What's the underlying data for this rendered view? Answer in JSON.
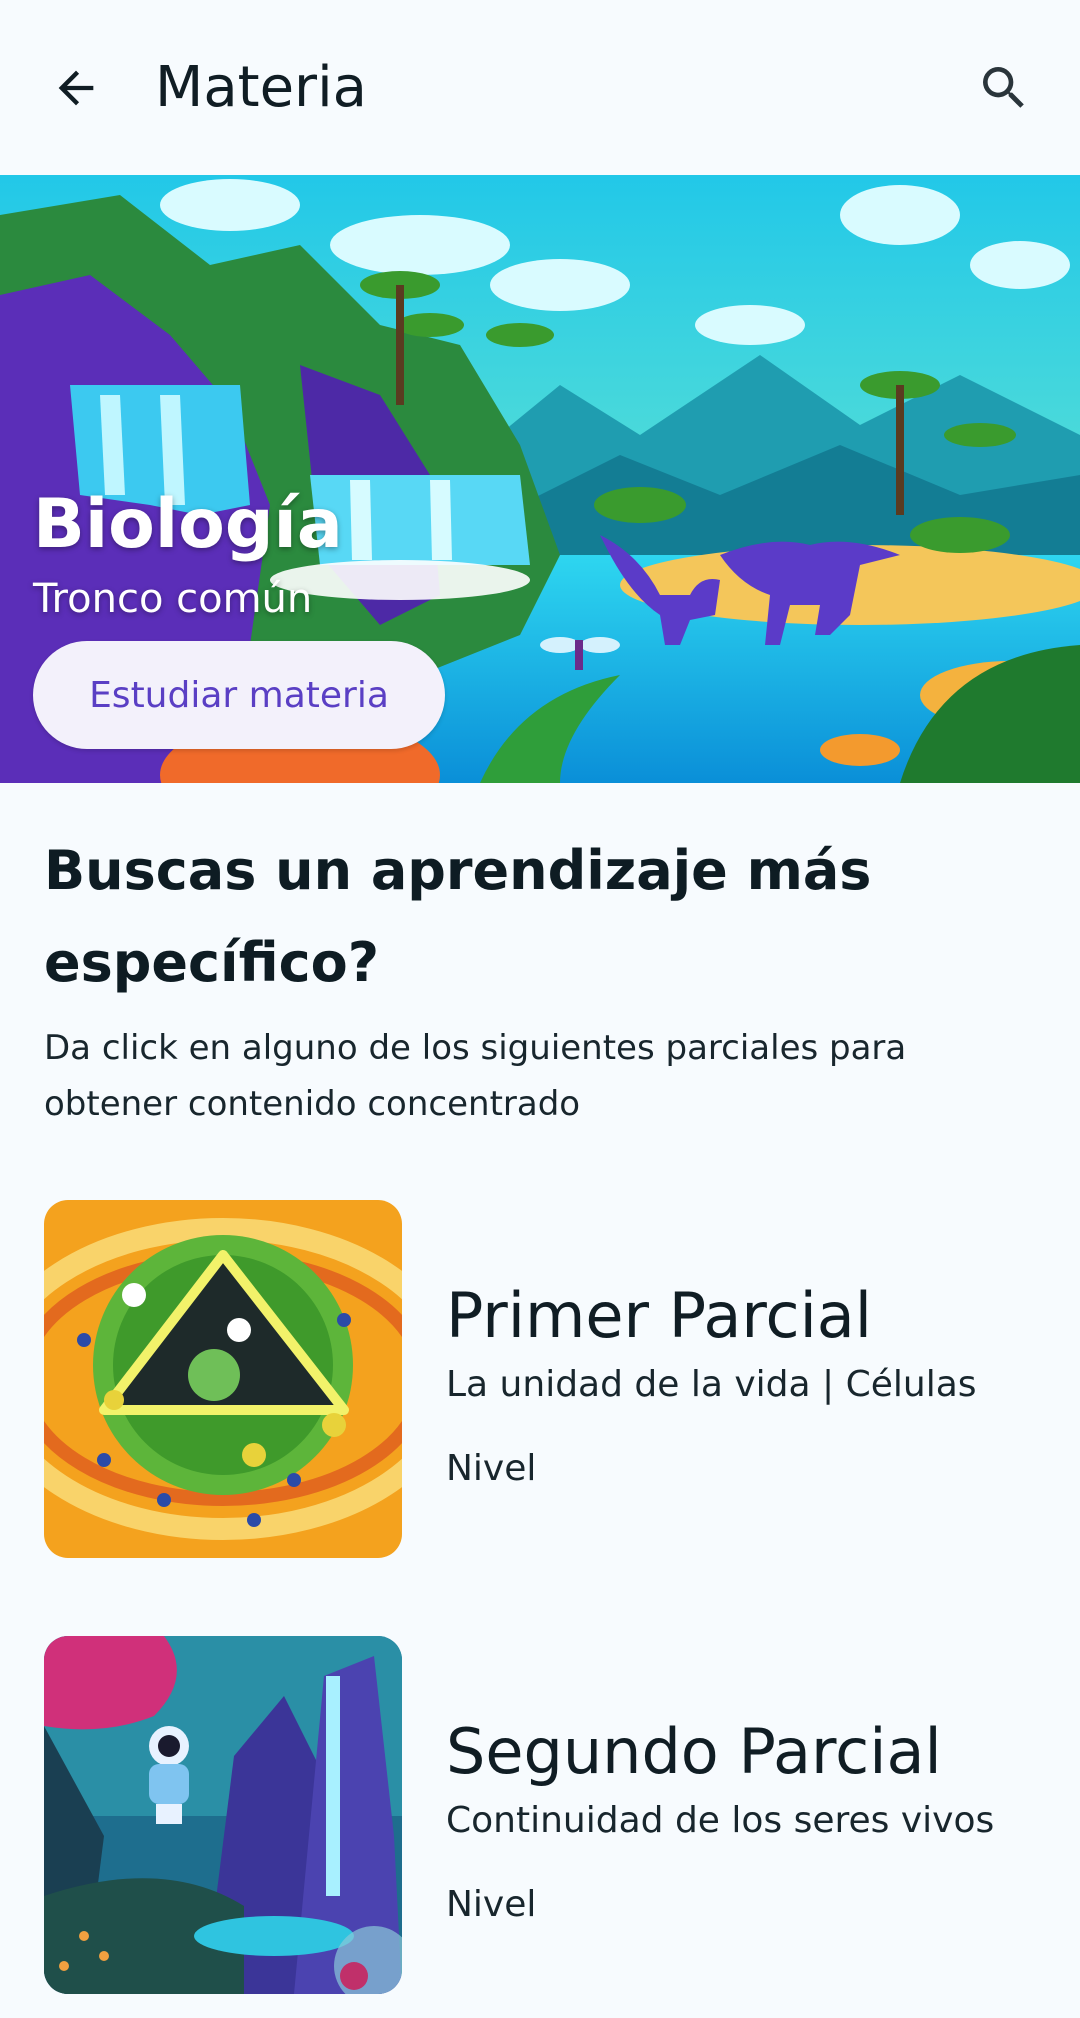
{
  "app_bar": {
    "title": "Materia",
    "back_icon": "arrow-left-icon",
    "search_icon": "search-icon"
  },
  "hero": {
    "title": "Biología",
    "subtitle": "Tronco común",
    "button_label": "Estudiar materia"
  },
  "section": {
    "heading": "Buscas un aprendizaje más específico?",
    "description": "Da click en alguno de los siguientes parciales para obtener contenido concentrado"
  },
  "partials": [
    {
      "title": "Primer Parcial",
      "subtitle": "La unidad de la vida | Células",
      "level_label": "Nivel"
    },
    {
      "title": "Segundo Parcial",
      "subtitle": "Continuidad de los seres vivos",
      "level_label": "Nivel"
    }
  ],
  "colors": {
    "background": "#F7FBFE",
    "accent": "#5A3FC4",
    "text": "#0F1D24"
  }
}
